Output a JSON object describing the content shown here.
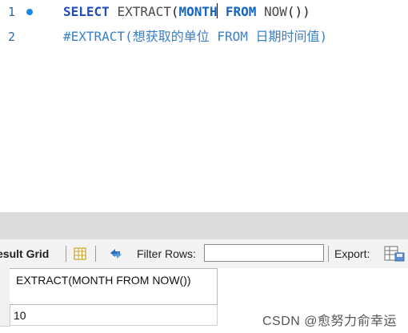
{
  "editor": {
    "lines": [
      {
        "number": "1",
        "has_marker": true
      },
      {
        "number": "2",
        "has_marker": false
      }
    ],
    "line1": {
      "kw_select": "SELECT",
      "fn_extract": "EXTRACT",
      "paren_open": "(",
      "kw_month": "MONTH",
      "kw_from": "FROM",
      "fn_now": "NOW",
      "paren_close": "())"
    },
    "line2": {
      "comment": "#EXTRACT(想获取的单位 FROM 日期时间值)"
    }
  },
  "toolbar": {
    "result_grid_label": "esult Grid",
    "filter_rows_label": "Filter Rows:",
    "filter_rows_value": "",
    "export_label": "Export:",
    "icons": [
      "grid-layout-icon",
      "refresh-icon",
      "export-file-icon"
    ]
  },
  "result_grid": {
    "columns": [
      "EXTRACT(MONTH FROM NOW())"
    ],
    "rows": [
      [
        "10"
      ]
    ]
  },
  "watermark": "CSDN @愈努力俞幸运"
}
